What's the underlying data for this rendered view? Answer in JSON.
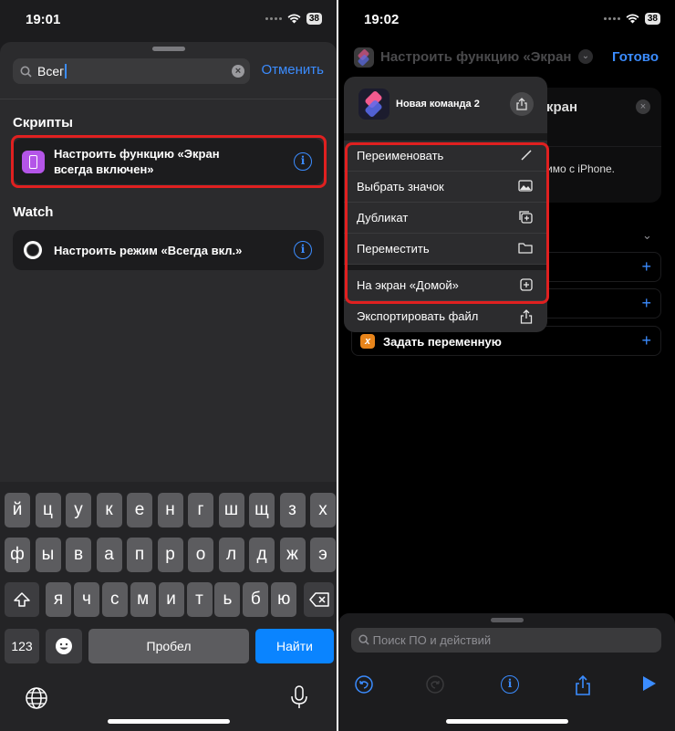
{
  "left": {
    "time": "19:01",
    "battery": "38",
    "search": {
      "value": "Всег",
      "cancel": "Отменить"
    },
    "sections": [
      {
        "title": "Скрипты",
        "item": {
          "line1": "Настроить функцию «Экран",
          "line2": "всегда включен»"
        }
      },
      {
        "title": "Watch",
        "item": {
          "line1": "Настроить режим «Всегда вкл.»",
          "line2": ""
        }
      }
    ],
    "keyboard": {
      "row1": [
        "й",
        "ц",
        "у",
        "к",
        "е",
        "н",
        "г",
        "ш",
        "щ",
        "з",
        "х"
      ],
      "row2": [
        "ф",
        "ы",
        "в",
        "а",
        "п",
        "р",
        "о",
        "л",
        "д",
        "ж",
        "э"
      ],
      "row3": [
        "я",
        "ч",
        "с",
        "м",
        "и",
        "т",
        "ь",
        "б",
        "ю"
      ],
      "num_key": "123",
      "space": "Пробел",
      "go": "Найти"
    }
  },
  "right": {
    "time": "19:02",
    "battery": "38",
    "header_title": "Настроить функцию «Экран",
    "done": "Готово",
    "bg_text": {
      "title_fragment": "кран",
      "desc_fragment": "имо с iPhone."
    },
    "bg_action": "Задать переменную",
    "menu": {
      "shortcut_name": "Новая команда 2",
      "items": [
        {
          "label": "Переименовать",
          "icon": "pencil-icon"
        },
        {
          "label": "Выбрать значок",
          "icon": "photo-icon"
        },
        {
          "label": "Дубликат",
          "icon": "duplicate-icon"
        },
        {
          "label": "Переместить",
          "icon": "folder-icon"
        },
        {
          "label": "На экран «Домой»",
          "icon": "add-square-icon"
        },
        {
          "label": "Экспортировать файл",
          "icon": "share-icon"
        }
      ]
    },
    "bottom_search": "Поиск ПО и действий",
    "accent": "#3b8cff",
    "highlight": "#e02020"
  }
}
